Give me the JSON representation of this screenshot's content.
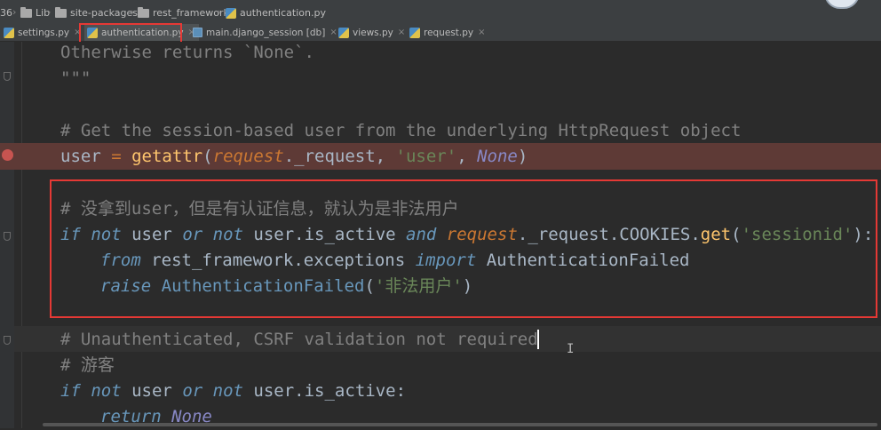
{
  "breadcrumbs": {
    "prefix": "36",
    "items": [
      "Lib",
      "site-packages",
      "rest_framework",
      "authentication.py"
    ]
  },
  "tabs": [
    {
      "label": "settings.py",
      "icon": "python-file-icon",
      "active": false
    },
    {
      "label": "authentication.py",
      "icon": "python-file-icon",
      "active": true
    },
    {
      "label": "main.django_session [db]",
      "icon": "database-table-icon",
      "active": false
    },
    {
      "label": "views.py",
      "icon": "python-file-icon",
      "active": false
    },
    {
      "label": "request.py",
      "icon": "python-file-icon",
      "active": false
    }
  ],
  "code": {
    "l1": "Otherwise returns `None`.",
    "l2": "\"\"\"",
    "l3": "# Get the session-based user from the underlying HttpRequest object",
    "l4": {
      "a": "user",
      "b": " = ",
      "c": "getattr",
      "d": "(",
      "e": "request",
      "f": "._request, ",
      "g": "'user'",
      "h": ", ",
      "i": "None",
      "j": ")"
    },
    "l5": "# 没拿到user，但是有认证信息，就认为是非法用户",
    "l6": {
      "a": "if",
      "b": " ",
      "c": "not",
      "d": " user ",
      "e": "or",
      "f": " ",
      "g": "not",
      "h": " user.is_active ",
      "i": "and",
      "j": " ",
      "k": "request",
      "l": "._request.COOKIES.",
      "m": "get",
      "n": "(",
      "o": "'sessionid'",
      "p": "):"
    },
    "l7": {
      "a": "from",
      "b": " rest_framework.exceptions ",
      "c": "import",
      "d": " AuthenticationFailed"
    },
    "l8": {
      "a": "raise",
      "b": " ",
      "c": "AuthenticationFailed",
      "d": "(",
      "e": "'非法用户'",
      "f": ")"
    },
    "l9": "# Unauthenticated, CSRF validation not required",
    "l10": "# 游客",
    "l11": {
      "a": "if",
      "b": " ",
      "c": "not",
      "d": " user ",
      "e": "or",
      "f": " ",
      "g": "not",
      "h": " user.is_active:"
    },
    "l12": {
      "a": "return",
      "b": " ",
      "c": "None"
    }
  },
  "colors": {
    "highlight_box": "#e53935",
    "breakpoint_line": "#5e3a36",
    "keyword": "#cc7832",
    "string": "#6a8759",
    "comment": "#808080"
  }
}
